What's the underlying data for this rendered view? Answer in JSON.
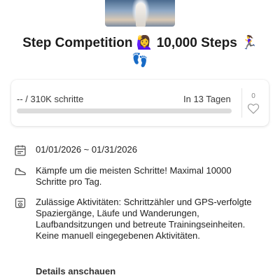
{
  "header": {
    "title_line1": "Step Competition 🙋‍♀️ 10,000  Steps 🏃‍♀️",
    "title_line2": "👣"
  },
  "progress_card": {
    "progress_text": "-- / 310K schritte",
    "days_left": "In 13 Tagen",
    "progress_fraction": 0.0,
    "like_count": "0",
    "icons": [
      "heart-icon"
    ]
  },
  "info": {
    "date_range": "01/01/2026 ~ 01/31/2026",
    "goal_text": "Kämpfe um die meisten Schritte! Maximal 10000 Schritte pro Tag.",
    "activities_text": "Zulässige Aktivitäten: Schrittzähler und GPS-verfolgte Spaziergänge, Läufe und Wanderungen, Laufbandsitzungen und betreute Trainingseinheiten. Keine manuell eingegebenen Aktivitäten.",
    "icons": [
      "calendar-icon",
      "shoe-icon",
      "checklist-icon"
    ]
  },
  "actions": {
    "details_label": "Details anschauen"
  },
  "colors": {
    "progress_track": "#dcdcdc",
    "text_primary": "#222222"
  }
}
